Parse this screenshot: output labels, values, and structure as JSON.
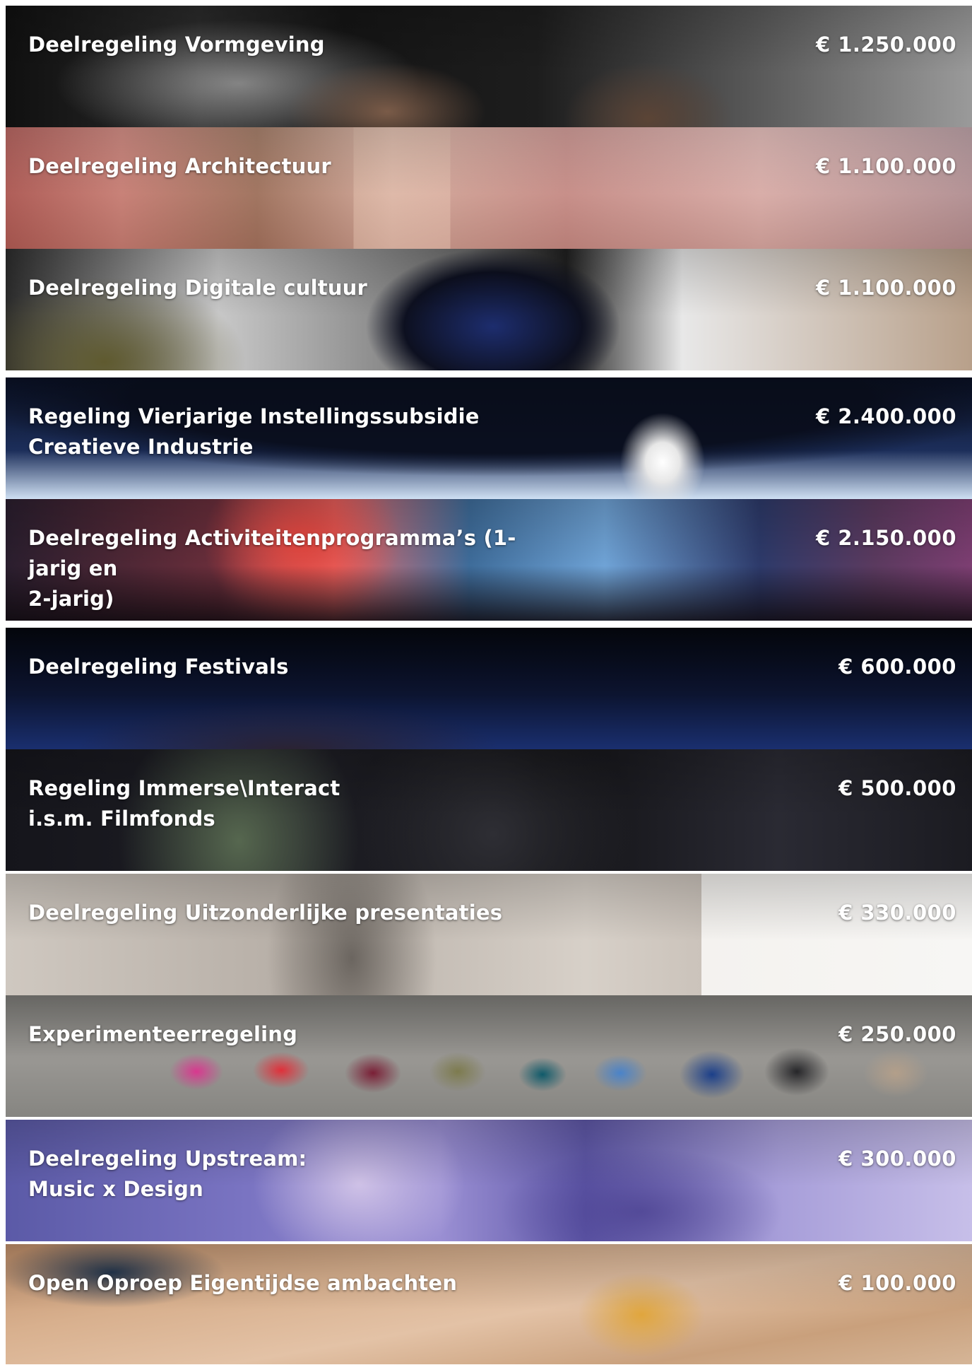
{
  "regelingen": [
    {
      "name": "Deelregeling Vormgeving",
      "amount": "€ 1.250.000"
    },
    {
      "name": "Deelregeling Architectuur",
      "amount": "€ 1.100.000"
    },
    {
      "name": "Deelregeling Digitale cultuur",
      "amount": "€ 1.100.000"
    },
    {
      "name": "Regeling Vierjarige Instellingssubsidie\nCreatieve Industrie",
      "amount": "€ 2.400.000"
    },
    {
      "name": "Deelregeling Activiteitenprogramma’s (1-jarig en\n2-jarig)",
      "amount": "€ 2.150.000"
    },
    {
      "name": "Deelregeling Festivals",
      "amount": "€ 600.000"
    },
    {
      "name": "Regeling Immerse\\Interact\ni.s.m. Filmfonds",
      "amount": "€ 500.000"
    },
    {
      "name": "Deelregeling Uitzonderlijke presentaties",
      "amount": "€ 330.000"
    },
    {
      "name": "Experimenteerregeling",
      "amount": "€ 250.000"
    },
    {
      "name": "Deelregeling Upstream:\nMusic x Design",
      "amount": "€ 300.000"
    },
    {
      "name": "Open Oproep Eigentijdse ambachten",
      "amount": "€ 100.000"
    }
  ]
}
